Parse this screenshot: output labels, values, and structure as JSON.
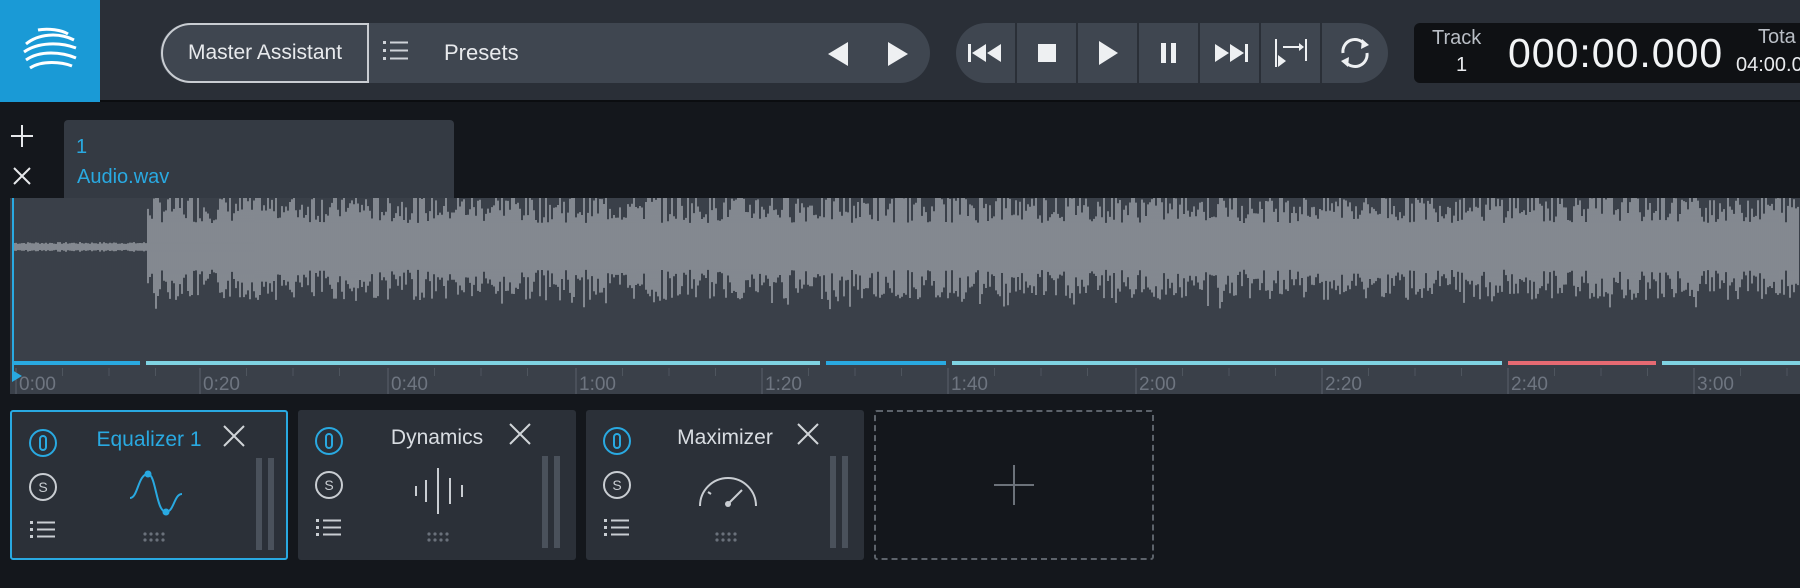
{
  "topbar": {
    "master_assistant": "Master Assistant",
    "presets": "Presets",
    "track_label": "Track",
    "track_number": "1",
    "time": "000:00.000",
    "total_label": "Tota",
    "total_value": "04:00.0"
  },
  "track": {
    "tab_number": "1",
    "tab_name": "Audio.wav"
  },
  "timeline": {
    "ticks": [
      "0:00",
      "0:20",
      "0:40",
      "1:00",
      "1:20",
      "1:40",
      "2:00",
      "2:20",
      "2:40",
      "3:00"
    ]
  },
  "modules": [
    {
      "name": "Equalizer 1",
      "active": true
    },
    {
      "name": "Dynamics",
      "active": false
    },
    {
      "name": "Maximizer",
      "active": false
    }
  ],
  "colors": {
    "accent": "#29a9e1",
    "segment_cyan": "#7fd3e2",
    "segment_red": "#e66a72"
  }
}
